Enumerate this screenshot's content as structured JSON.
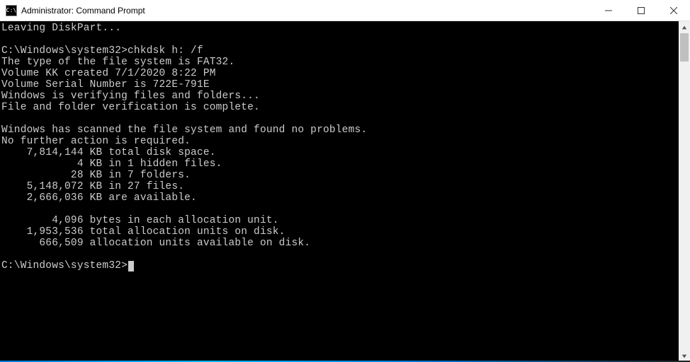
{
  "window": {
    "title": "Administrator: Command Prompt",
    "icon_label": "C:\\"
  },
  "terminal": {
    "lines": [
      "Leaving DiskPart...",
      "",
      "C:\\Windows\\system32>chkdsk h: /f",
      "The type of the file system is FAT32.",
      "Volume KK created 7/1/2020 8:22 PM",
      "Volume Serial Number is 722E-791E",
      "Windows is verifying files and folders...",
      "File and folder verification is complete.",
      "",
      "Windows has scanned the file system and found no problems.",
      "No further action is required.",
      "    7,814,144 KB total disk space.",
      "            4 KB in 1 hidden files.",
      "           28 KB in 7 folders.",
      "    5,148,072 KB in 27 files.",
      "    2,666,036 KB are available.",
      "",
      "        4,096 bytes in each allocation unit.",
      "    1,953,536 total allocation units on disk.",
      "      666,509 allocation units available on disk.",
      ""
    ],
    "prompt": "C:\\Windows\\system32>"
  }
}
